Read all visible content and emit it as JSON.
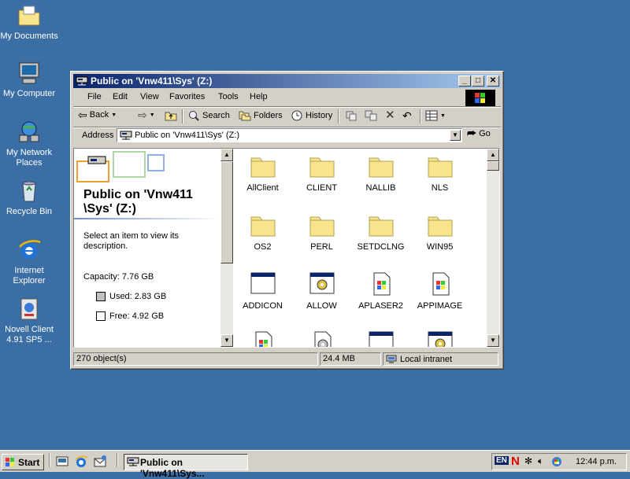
{
  "desktop": {
    "icons": [
      {
        "label": "My Documents",
        "icon": "folder-documents-icon"
      },
      {
        "label": "My Computer",
        "icon": "computer-icon"
      },
      {
        "label": "My Network Places",
        "icon": "network-places-icon"
      },
      {
        "label": "Recycle Bin",
        "icon": "recycle-bin-icon"
      },
      {
        "label": "Internet Explorer",
        "icon": "internet-explorer-icon"
      },
      {
        "label": "Novell Client 4.91 SP5 ...",
        "icon": "novell-client-icon"
      }
    ]
  },
  "window": {
    "title": "Public on 'Vnw411\\Sys' (Z:)",
    "menu": [
      "File",
      "Edit",
      "View",
      "Favorites",
      "Tools",
      "Help"
    ],
    "toolbar": {
      "back": "Back",
      "search": "Search",
      "folders": "Folders",
      "history": "History"
    },
    "address": {
      "label": "Address",
      "value": "Public on 'Vnw411\\Sys' (Z:)",
      "go": "Go"
    },
    "left_pane": {
      "title_line1": "Public on 'Vnw411",
      "title_line2": "\\Sys' (Z:)",
      "hint": "Select an item to view its description.",
      "capacity": "Capacity: 7.76 GB",
      "used": "Used: 2.83 GB",
      "free": "Free: 4.92 GB"
    },
    "items": [
      {
        "name": "AllClient",
        "type": "folder"
      },
      {
        "name": "CLIENT",
        "type": "folder"
      },
      {
        "name": "NALLIB",
        "type": "folder"
      },
      {
        "name": "NLS",
        "type": "folder"
      },
      {
        "name": "OS2",
        "type": "folder"
      },
      {
        "name": "PERL",
        "type": "folder"
      },
      {
        "name": "SETDCLNG",
        "type": "folder"
      },
      {
        "name": "WIN95",
        "type": "folder"
      },
      {
        "name": "ADDICON",
        "type": "app-window"
      },
      {
        "name": "ALLOW",
        "type": "app-gear"
      },
      {
        "name": "APLASER2",
        "type": "doc-win"
      },
      {
        "name": "APPIMAGE",
        "type": "doc-win"
      },
      {
        "name": "",
        "type": "doc-win"
      },
      {
        "name": "",
        "type": "doc-gear"
      },
      {
        "name": "",
        "type": "app-window"
      },
      {
        "name": "",
        "type": "app-gear"
      }
    ],
    "status": {
      "objects": "270 object(s)",
      "size": "24.4 MB",
      "zone": "Local intranet"
    }
  },
  "taskbar": {
    "start": "Start",
    "task": "Public on 'Vnw411\\Sys...",
    "lang": "EN",
    "clock": "12:44 p.m."
  },
  "colors": {
    "desktop": "#3a6ea5",
    "titlebar_start": "#0a246a",
    "titlebar_end": "#a6caf0",
    "face": "#d4d0c8",
    "folder": "#f8e48c"
  }
}
